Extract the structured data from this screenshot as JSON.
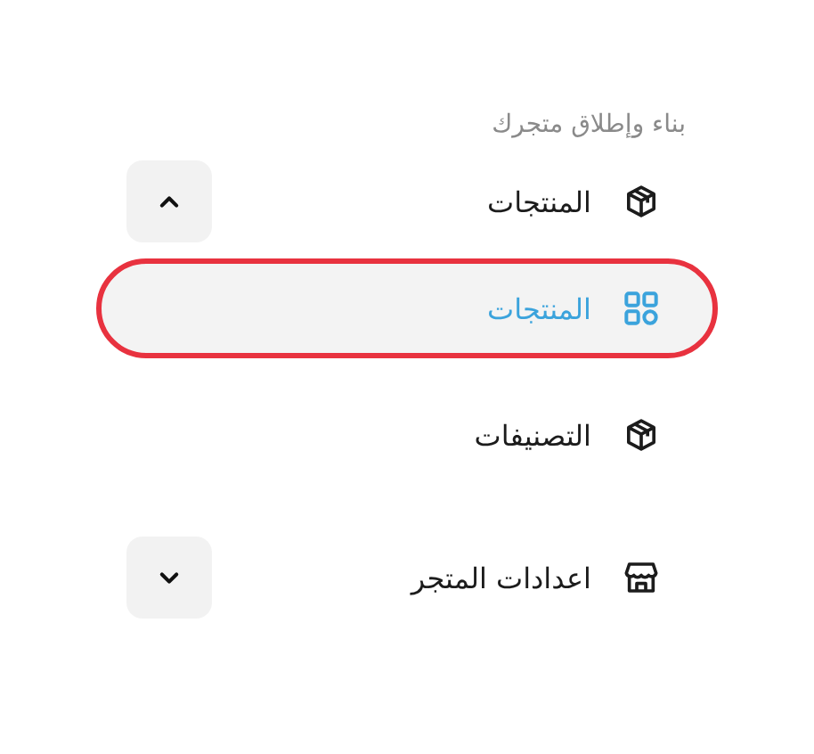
{
  "section_title": "بناء وإطلاق متجرك",
  "items": [
    {
      "kind": "group",
      "label": "المنتجات",
      "expanded": true,
      "children": [
        {
          "kind": "link",
          "label": "المنتجات",
          "selected": true,
          "highlighted": true
        }
      ]
    },
    {
      "kind": "link",
      "label": "التصنيفات",
      "selected": false,
      "highlighted": false
    },
    {
      "kind": "group",
      "label": "اعدادات المتجر",
      "expanded": false
    }
  ]
}
